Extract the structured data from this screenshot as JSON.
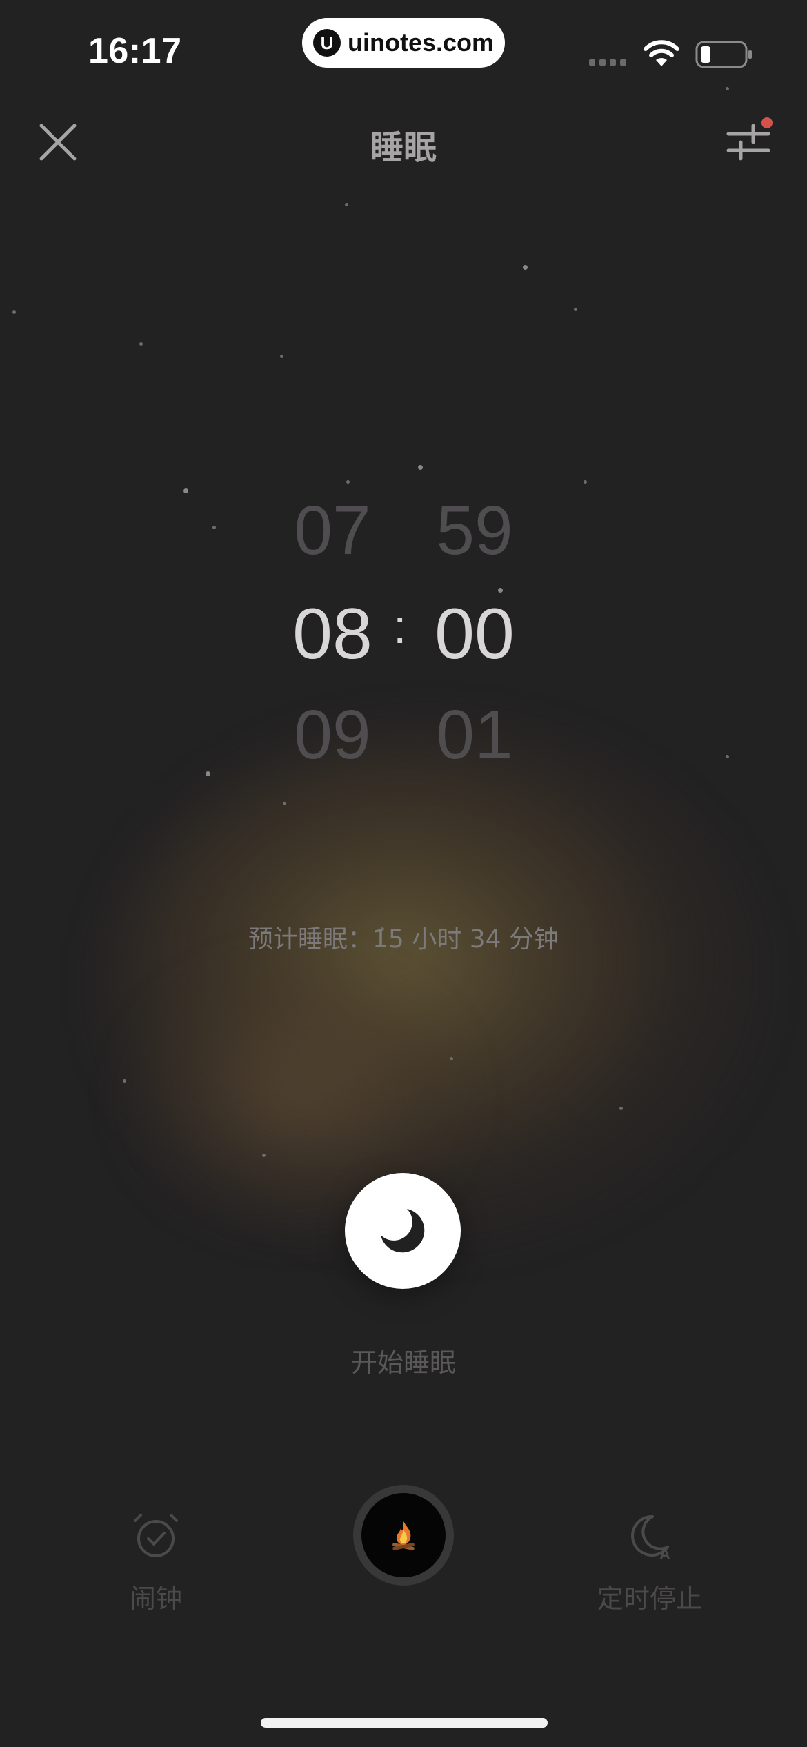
{
  "status_bar": {
    "time": "16:17",
    "watermark_logo": "U",
    "watermark_text": "uinotes.com",
    "icons": [
      "signal-icon",
      "wifi-icon",
      "battery-icon"
    ]
  },
  "header": {
    "title": "睡眠",
    "left_icon": "close-icon",
    "right_icon": "sliders-icon",
    "notification_dot_color": "#d4524b"
  },
  "time_picker": {
    "hours": {
      "previous": "07",
      "selected": "08",
      "next": "09"
    },
    "minutes": {
      "previous": "59",
      "selected": "00",
      "next": "01"
    },
    "separator": ":"
  },
  "estimate": {
    "text": "预计睡眠：15 小时 34 分钟"
  },
  "start_button": {
    "icon": "moon-icon",
    "label": "开始睡眠"
  },
  "bottom_bar": {
    "alarm": {
      "icon": "alarm-clock-icon",
      "label": "闹钟"
    },
    "sound": {
      "icon": "campfire-icon",
      "glyph": "🔥"
    },
    "timer": {
      "icon": "moon-timer-icon",
      "badge": "A",
      "label": "定时停止"
    }
  },
  "colors": {
    "background": "#232223",
    "glow": "#685c38",
    "primary_text": "#d8d6d7",
    "muted_text": "#7d7a7b"
  }
}
